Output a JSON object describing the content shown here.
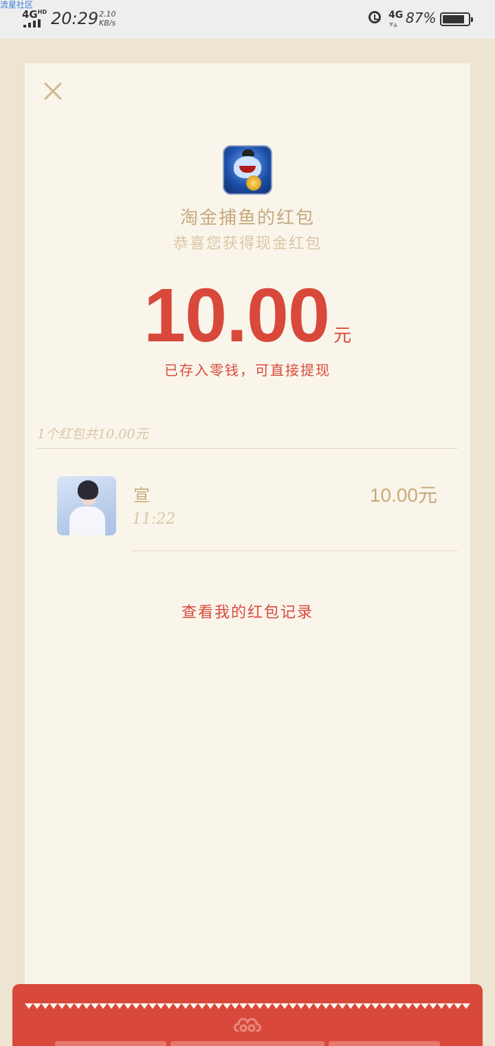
{
  "status_bar": {
    "watermark": "流星社区",
    "network": "4G",
    "network_hd": "HD",
    "time": "20:29",
    "speed_value": "2.10",
    "speed_unit": "KB/s",
    "network_right": "4G",
    "battery_percent": "87%",
    "battery_level": 0.87
  },
  "packet": {
    "close_icon": "close-icon",
    "app_icon": "fishing-game-app-icon",
    "title": "淘金捕鱼的红包",
    "subtitle": "恭喜您获得现金红包",
    "amount": "10.00",
    "amount_unit": "元",
    "amount_note": "已存入零钱，可直接提现",
    "summary": "1个红包共10.00元"
  },
  "recipients": [
    {
      "name": "宣",
      "time": "11:22",
      "amount": "10.00元"
    }
  ],
  "footer": {
    "records_link": "查看我的红包记录"
  },
  "colors": {
    "background": "#ede4d2",
    "card": "#faf5eb",
    "accent_red": "#d8493c",
    "gold_text": "#c6a97c",
    "light_gold_text": "#d9c6a6"
  }
}
